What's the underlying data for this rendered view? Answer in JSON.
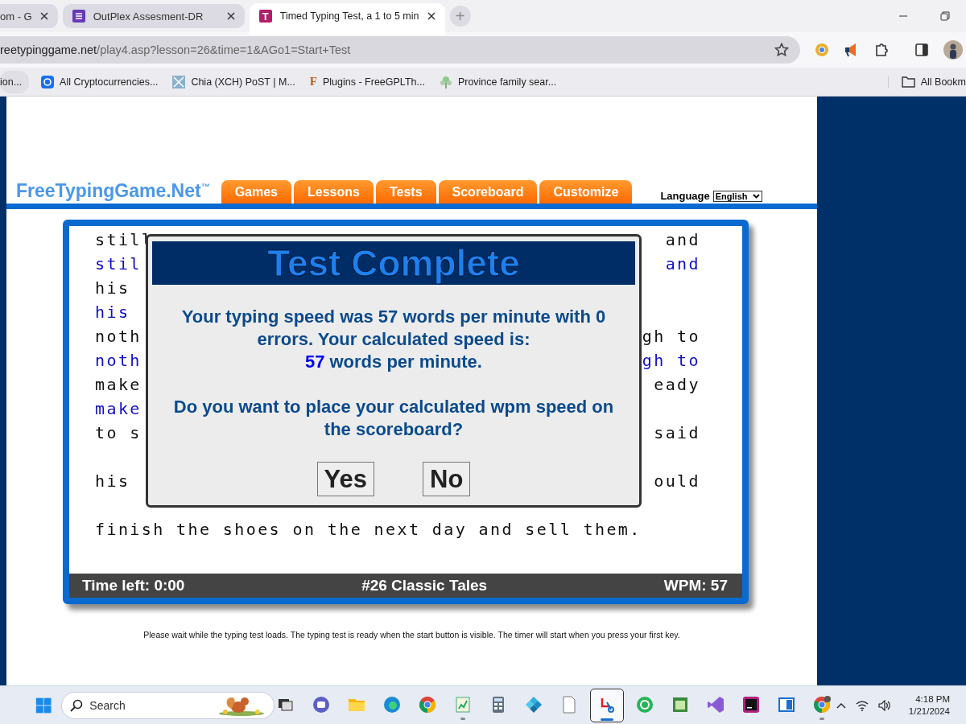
{
  "browser": {
    "tabs": [
      {
        "title": "om - G",
        "selected": false
      },
      {
        "title": "OutPlex Assesment-DR",
        "selected": false
      },
      {
        "title": "Timed Typing Test, a 1 to 5 min",
        "selected": true,
        "favicon_letter": "T"
      }
    ],
    "new_tab": "+",
    "url": {
      "host": "reetypinggame.net",
      "path": "/play4.asp?lesson=26&time=1&AGo1=Start+Test"
    },
    "bookmarks": [
      {
        "title": "ion..."
      },
      {
        "title": "All Cryptocurrencies..."
      },
      {
        "title": "Chia (XCH) PoST | M..."
      },
      {
        "title": "Plugins - FreeGPLTh...",
        "icon_text": "F"
      },
      {
        "title": "Province family sear..."
      }
    ],
    "all_bookmarks": "All Bookm"
  },
  "site": {
    "logo": "FreeTypingGame.Net",
    "logo_mark": "™",
    "nav": [
      "Games",
      "Lessons",
      "Tests",
      "Scoreboard",
      "Customize"
    ],
    "language_label": "Language",
    "language": "English"
  },
  "typing": {
    "lines": [
      {
        "kind": "source",
        "left": "still",
        "right": "and"
      },
      {
        "kind": "typed",
        "left": "stil",
        "right": "and"
      },
      {
        "kind": "source",
        "left": "his"
      },
      {
        "kind": "typed",
        "left": "his"
      },
      {
        "kind": "source",
        "left": "noth",
        "right": "gh to"
      },
      {
        "kind": "typed",
        "left": "noth",
        "right": "gh to"
      },
      {
        "kind": "source",
        "left": "make",
        "right": "eady"
      },
      {
        "kind": "typed",
        "left": "make"
      },
      {
        "kind": "source",
        "left": "to s",
        "right": "said"
      },
      {
        "kind": "blank"
      },
      {
        "kind": "source",
        "left": "his",
        "right": "ould"
      },
      {
        "kind": "blank"
      },
      {
        "kind": "source",
        "left": "finish the shoes on the next day and sell them."
      }
    ]
  },
  "dialog": {
    "title": "Test Complete",
    "message": "Your typing speed was 57 words per minute with 0 errors. Your calculated speed is:",
    "speed": "57",
    "speed_unit": "words per minute.",
    "question": "Do you want to place your calculated wpm speed on the scoreboard?",
    "buttons": [
      "Yes",
      "No"
    ]
  },
  "status_bar": {
    "time_left": "Time left: 0:00",
    "lesson": "#26 Classic Tales",
    "wpm": "WPM: 57"
  },
  "footer_note": "Please wait while the typing test loads. The typing test is ready when the start button is visible. The timer will start when you press your first key.",
  "taskbar": {
    "search": {
      "placeholder": "Search"
    },
    "apps": [
      {
        "running": false,
        "selected": false
      },
      {
        "running": false,
        "selected": false
      },
      {
        "running": false,
        "selected": false
      },
      {
        "running": false,
        "selected": false
      },
      {
        "running": false,
        "selected": false
      },
      {
        "running": true,
        "selected": false
      },
      {
        "running": false,
        "selected": false
      },
      {
        "running": false,
        "selected": false
      },
      {
        "running": false,
        "selected": false
      },
      {
        "running": true,
        "selected": true
      },
      {
        "running": false,
        "selected": false
      },
      {
        "running": false,
        "selected": false
      },
      {
        "running": false,
        "selected": false
      },
      {
        "running": false,
        "selected": false
      },
      {
        "running": false,
        "selected": false
      },
      {
        "running": true,
        "selected": false
      }
    ],
    "time": "4:18 PM",
    "date": "1/21/2024"
  }
}
